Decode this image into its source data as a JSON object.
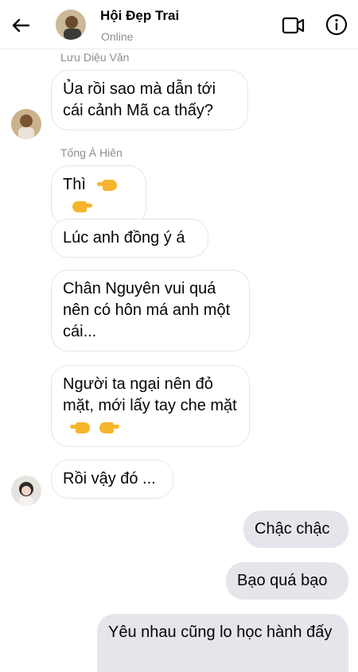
{
  "header": {
    "contact_name": "Hội Đẹp Trai",
    "status": "Online",
    "back_icon": "arrow-left-icon",
    "video_icon": "video-camera-icon",
    "info_icon": "info-circle-icon"
  },
  "messages": [
    {
      "sender": "Lưu Diệu Văn",
      "text": "Ủa rồi sao mà dẫn tới cái cảnh Mã ca thấy?",
      "direction": "incoming"
    },
    {
      "sender": "Tống Á Hiên",
      "text": "Thì",
      "emoji": "👉👈",
      "direction": "incoming"
    },
    {
      "text": "Lúc anh đồng ý á",
      "direction": "incoming"
    },
    {
      "text": "Chân Nguyên vui quá nên có hôn má anh một cái...",
      "direction": "incoming"
    },
    {
      "text": "Người ta ngại nên đỏ mặt, mới lấy tay che mặt",
      "emoji": "👉👈",
      "direction": "incoming"
    },
    {
      "text": "Rồi vậy đó ...",
      "direction": "incoming"
    },
    {
      "text": "Chậc chậc",
      "direction": "outgoing"
    },
    {
      "text": "Bạo quá bạo",
      "direction": "outgoing"
    },
    {
      "text": "Yêu nhau cũng lo học hành đấy",
      "direction": "outgoing"
    }
  ],
  "colors": {
    "incoming_bubble": "#ffffff",
    "incoming_border": "#e4e6eb",
    "outgoing_bubble": "#e4e6eb",
    "secondary_text": "#8a8d91"
  }
}
